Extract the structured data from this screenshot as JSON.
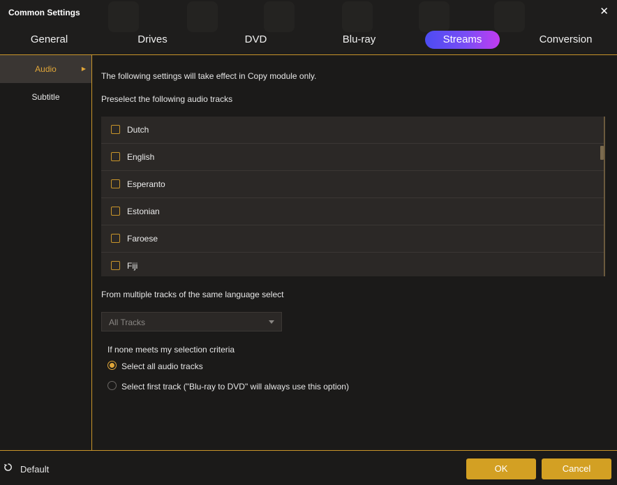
{
  "window": {
    "title": "Common Settings",
    "close_glyph": "✕"
  },
  "tabs": [
    {
      "label": "General"
    },
    {
      "label": "Drives"
    },
    {
      "label": "DVD"
    },
    {
      "label": "Blu-ray"
    },
    {
      "label": "Streams",
      "active": true
    },
    {
      "label": "Conversion"
    }
  ],
  "sidebar": {
    "items": [
      {
        "label": "Audio",
        "active": true,
        "arrow": "▶"
      },
      {
        "label": "Subtitle"
      }
    ]
  },
  "main": {
    "note": "The following settings will take effect in Copy module only.",
    "preselect_label": "Preselect the following audio tracks",
    "languages": [
      {
        "label": "Dutch",
        "checked": false
      },
      {
        "label": "English",
        "checked": false
      },
      {
        "label": "Esperanto",
        "checked": false
      },
      {
        "label": "Estonian",
        "checked": false
      },
      {
        "label": "Faroese",
        "checked": false
      },
      {
        "label": "Fiji",
        "checked": false
      }
    ],
    "multi_label": "From multiple tracks of the same language select",
    "track_select": {
      "value": "All Tracks"
    },
    "none_label": "If none meets my selection criteria",
    "options": [
      {
        "label": "Select all audio tracks",
        "checked": true
      },
      {
        "label": "Select first track (\"Blu-ray to DVD\" will always use this option)",
        "checked": false
      }
    ]
  },
  "footer": {
    "default_label": "Default",
    "ok_label": "OK",
    "cancel_label": "Cancel"
  },
  "colors": {
    "accent": "#d3a023",
    "background": "#1b1a19",
    "tab_active_gradient": [
      "#4c4cf2",
      "#c23cf2"
    ]
  },
  "icons": {
    "close": "close-icon",
    "sidebar_arrow": "caret-right-icon",
    "select_caret": "chevron-down-icon",
    "default": "reset-icon"
  }
}
